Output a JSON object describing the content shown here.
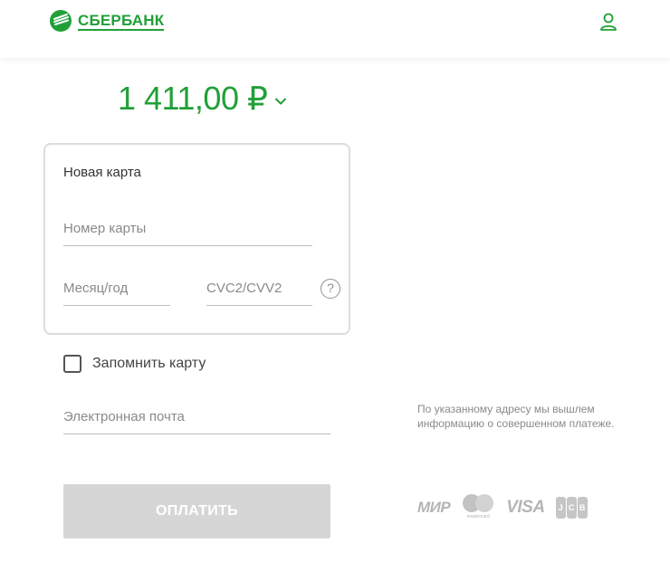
{
  "header": {
    "logo_text": "СБЕРБАНК",
    "brand_color": "#21a038",
    "user_icon": "user-icon"
  },
  "payment": {
    "amount": "1 411,00 ₽",
    "amount_dropdown_icon": "chevron-down-icon"
  },
  "card_form": {
    "title": "Новая карта",
    "card_number_placeholder": "Номер карты",
    "card_number_value": "",
    "month_year_placeholder": "Месяц/год",
    "month_year_value": "",
    "cvc_placeholder": "CVC2/CVV2",
    "cvc_value": "",
    "help_icon": "question-icon",
    "help_symbol": "?"
  },
  "remember_card": {
    "label": "Запомнить карту",
    "checked": false
  },
  "email": {
    "placeholder": "Электронная почта",
    "value": "",
    "note": "По указанному адресу мы вышлем информацию о совершенном платеже."
  },
  "pay_button": {
    "label": "ОПЛАТИТЬ",
    "disabled_color": "#d6d6d6"
  },
  "payment_systems": {
    "mir": "МИР",
    "mastercard_caption": "mastercard",
    "visa": "VISA",
    "jcb": [
      "J",
      "C",
      "B"
    ]
  }
}
